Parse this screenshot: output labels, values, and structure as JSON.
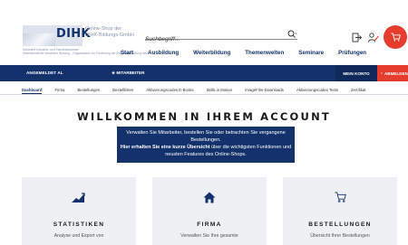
{
  "header": {
    "logo_text": "DIHK",
    "logo_sub_a": "Deutsche Industrie- und Handelskammer",
    "logo_sub_b": "Gesellschaft für berufliche Bildung – Organisation zur Förderung der IHK-Weiterbildung mbH",
    "shop_name_line1": "Online-Shop der",
    "shop_name_line2": "DIHK-Bildungs-GmbH",
    "search_placeholder": "Suchbegriff...",
    "nav": [
      "Start",
      "Ausbildung",
      "Weiterbildung",
      "Themenwelten",
      "Seminare",
      "Prüfungen"
    ]
  },
  "bluebar": {
    "account_label": "ANGEMELDET AL",
    "mitarbeiter_label": "★ MITARBEITER",
    "konto_label": "MEIN KONTO",
    "abmelden_label": "ABMELDEN"
  },
  "tabs": [
    "Dashboard",
    "Firma",
    "Bestellungen",
    "Bestelllisten",
    "Aktivierungscodes E-Books",
    "Skills in Motion",
    "ImageFilm-Downloads",
    "Aktivierungscodes Tests",
    "Zertifikat"
  ],
  "welcome": {
    "title": "WILLKOMMEN IN IHREM ACCOUNT",
    "line1": "Verwalten Sie Mitarbeiter, bestellen Sie oder betrachten Sie vergangene",
    "line2": "Bestellungen.",
    "line3_bold": "Hier erhalten Sie eine kurze Übersicht",
    "line3_rest": " über die wichtigsten Funktionen und",
    "line4": "neusten Features des Online-Shops."
  },
  "cards": [
    {
      "icon": "chart-icon",
      "title": "STATISTIKEN",
      "desc": "Analyse und Export von"
    },
    {
      "icon": "home-icon",
      "title": "FIRMA",
      "desc": "Verwalten Sie Ihre gesamte"
    },
    {
      "icon": "cart-icon",
      "title": "BESTELLUNGEN",
      "desc": "Übersicht Ihrer Bestellungen"
    }
  ],
  "colors": {
    "brand_blue": "#13326b",
    "accent_red": "#e53c2e",
    "card_bg": "#eef0f3"
  }
}
